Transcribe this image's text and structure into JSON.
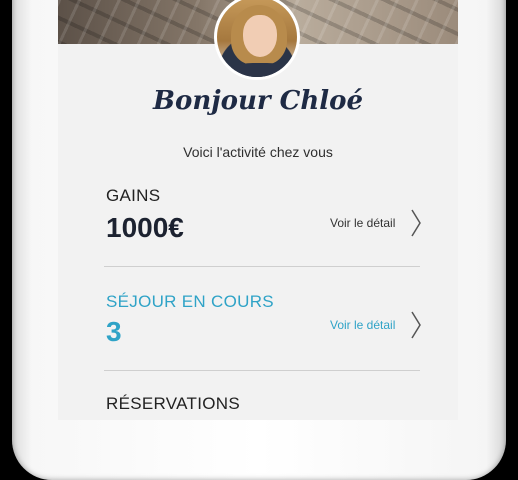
{
  "profile": {
    "greeting": "Bonjour Chloé",
    "subtitle": "Voici l'activité chez vous"
  },
  "cards": [
    {
      "label": "GAINS",
      "value": "1000€",
      "link": "Voir le détail"
    },
    {
      "label": "SÉJOUR EN COURS",
      "value": "3",
      "link": "Voir le détail",
      "accent": "#2fa3c7"
    },
    {
      "label": "RÉSERVATIONS",
      "value": "",
      "link": ""
    }
  ],
  "colors": {
    "accent": "#2fa3c7",
    "title": "#1e2a44"
  },
  "icons": [
    "chevron-right-icon"
  ]
}
